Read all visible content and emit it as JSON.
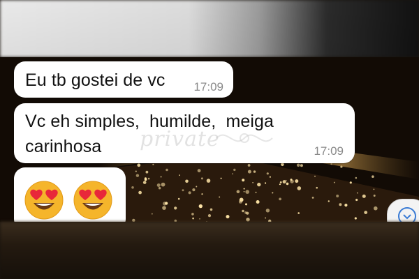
{
  "messages": [
    {
      "text": "Eu tb gostei de vc",
      "time": "17:09"
    },
    {
      "text": "Vc eh simples,  humilde,  meiga\ncarinhosa",
      "time": "17:09"
    },
    {
      "emojis": [
        "heart-eyes-emoji",
        "heart-eyes-emoji"
      ]
    }
  ],
  "watermark": {
    "text": "private"
  },
  "colors": {
    "bubble": "#ffffff",
    "time": "#8a8a8a",
    "emoji_face": "#f5b52b",
    "heart": "#e8283a"
  }
}
